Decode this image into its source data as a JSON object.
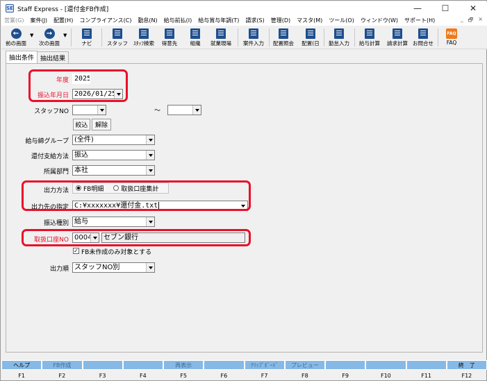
{
  "window": {
    "app_icon": "SE",
    "title": "Staff Express - [還付金FB作成]",
    "minimize": "—",
    "maximize": "☐",
    "close": "✕"
  },
  "menu": {
    "items": [
      "営業(G)",
      "案件(J)",
      "配置(H)",
      "コンプライアンス(C)",
      "勤怠(N)",
      "給与前払(I)",
      "給与賞与年調(T)",
      "請求(S)",
      "管理(D)",
      "マスタ(M)",
      "ツール(O)",
      "ウィンドウ(W)",
      "サポート(H)"
    ],
    "mdi_min": "_",
    "mdi_restore": "🗗",
    "mdi_close": "×"
  },
  "toolbar": {
    "back": "前の画面",
    "forward": "次の画面",
    "navi": "ナビ",
    "staff": "スタッフ",
    "staff_search": "ｽﾀｯﾌ検索",
    "customer": "得意先",
    "org": "組織",
    "site": "就業現場",
    "case_input": "案件入力",
    "assign_inquiry": "配置照会",
    "assign_day": "配置(日",
    "attendance_input": "勤怠入力",
    "payroll_calc": "給与計算",
    "billing_calc": "請求計算",
    "inquiry": "お問合せ",
    "faq": "FAQ",
    "faq_icon_text": "FAQ"
  },
  "tabs": [
    "抽出条件",
    "抽出結果"
  ],
  "form": {
    "year_label": "年度",
    "year_value": "2025",
    "transfer_date_label": "振込年月日",
    "transfer_date_value": "2026/01/25",
    "staff_no_label": "スタッフNO",
    "staff_no_from": "",
    "staff_no_to": "",
    "range_sep": "～",
    "narrow_button": "絞込",
    "clear_button": "解除",
    "pay_group_label": "給与締グループ",
    "pay_group_value": "(全件)",
    "refund_method_label": "還付支給方法",
    "refund_method_value": "振込",
    "department_label": "所属部門",
    "department_value": "本社",
    "output_method_label": "出力方法",
    "output_method_options": [
      "FB明細",
      "取扱口座集計"
    ],
    "output_method_selected": "FB明細",
    "output_dest_label": "出力先の指定",
    "output_dest_value": "C:¥xxxxxxx¥還付金.txt",
    "transfer_type_label": "振込種別",
    "transfer_type_value": "給与",
    "bank_account_label": "取扱口座NO",
    "bank_account_no": "0004",
    "bank_name": "セブン銀行",
    "fb_uncreated_only_label": "FB未作成のみ対象とする",
    "fb_uncreated_only_checked": true,
    "check_mark": "✓",
    "output_order_label": "出力順",
    "output_order_value": "スタッフNO別"
  },
  "function_keys": [
    {
      "key": "F1",
      "label": "ヘルプ"
    },
    {
      "key": "F2",
      "label": "FB作成"
    },
    {
      "key": "F3",
      "label": ""
    },
    {
      "key": "F4",
      "label": ""
    },
    {
      "key": "F5",
      "label": "再表示"
    },
    {
      "key": "F6",
      "label": ""
    },
    {
      "key": "F7",
      "label": "ｸﾘｯﾌﾟﾎﾞｰﾄﾞ"
    },
    {
      "key": "F8",
      "label": "プレビュー"
    },
    {
      "key": "F9",
      "label": ""
    },
    {
      "key": "F10",
      "label": ""
    },
    {
      "key": "F11",
      "label": ""
    },
    {
      "key": "F12",
      "label": "終　了"
    }
  ],
  "colors": {
    "highlight": "#e8102a",
    "label_red": "#e8102a",
    "fkey_bg": "#87b9e6",
    "icon_blue": "#1f4f8f",
    "faq_orange": "#f07a1a"
  }
}
